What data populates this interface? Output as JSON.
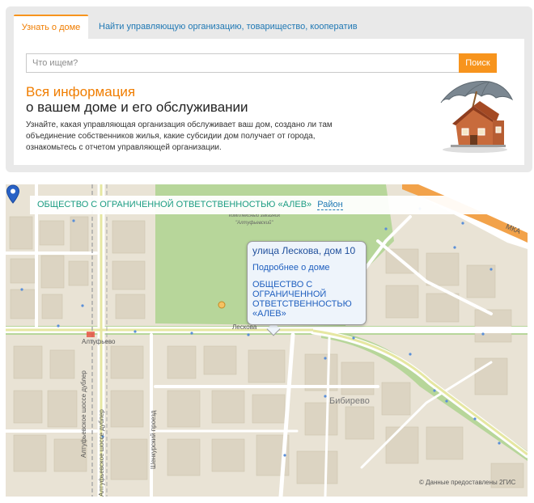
{
  "tabs": {
    "active": "Узнать о доме",
    "link": "Найти управляющую организацию, товарищество, кооператив"
  },
  "search": {
    "placeholder": "Что ищем?",
    "button": "Поиск"
  },
  "info": {
    "title_line1": "Вся информация",
    "title_line2": "о вашем доме и его обслуживании",
    "description": "Узнайте, какая управляющая организация обслуживает ваш дом, создано ли там объединение собственников жилья, какие субсидии дом получает от города, ознакомьтесь с отчетом управляющей организации."
  },
  "map": {
    "org_name": "ОБЩЕСТВО С ОГРАНИЧЕННОЙ ОТВЕТСТВЕННОСТЬЮ «АЛЕВ»",
    "district_link": "Район",
    "popup": {
      "address": "улица Лескова, дом 10",
      "more_link": "Подробнее о доме",
      "org_link": "ОБЩЕСТВО С ОГРАНИЧЕННОЙ ОТВЕТСТВЕННОСТЬЮ «АЛЕВ»"
    },
    "labels": {
      "reserve_line1": "комплексный заказник",
      "reserve_line2": "\"Алтуфьевский\"",
      "street_leskova": "Лескова",
      "altufyevo": "Алтуфьево",
      "bibirevo": "Бибирево",
      "mkad": "МКА",
      "altuf_doubler1": "Алтуфьевское шоссе дублер",
      "altuf_doubler2": "Алтуфьевское шоссе дублер",
      "shenkursky": "Шенкурский проезд"
    },
    "credit": "© Данные предоставлены 2ГИС",
    "colors": {
      "park": "#b5d496",
      "road": "#ffffff",
      "main_road": "#e7e9a6",
      "mkad": "#f0a24a",
      "rail": "#9a9a9a",
      "pin": "#2962c6"
    }
  }
}
